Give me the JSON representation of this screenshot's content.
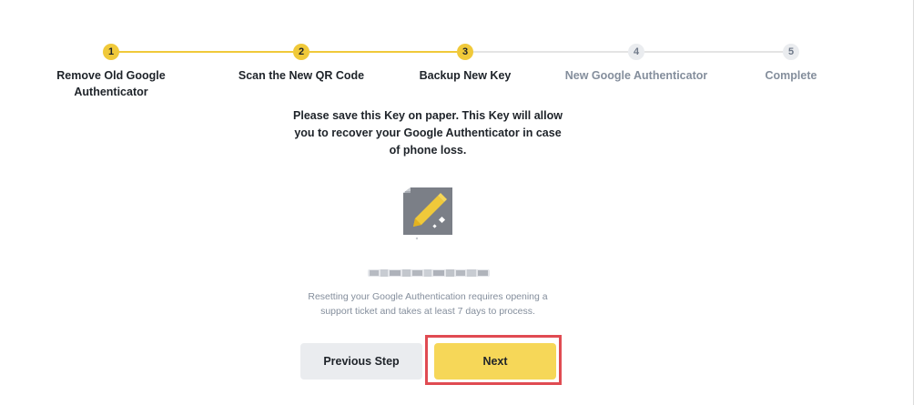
{
  "stepper": {
    "steps": [
      {
        "number": "1",
        "label": "Remove Old Google Authenticator",
        "state": "complete"
      },
      {
        "number": "2",
        "label": "Scan the New QR Code",
        "state": "complete"
      },
      {
        "number": "3",
        "label": "Backup New Key",
        "state": "current"
      },
      {
        "number": "4",
        "label": "New Google Authenticator",
        "state": "upcoming"
      },
      {
        "number": "5",
        "label": "Complete",
        "state": "upcoming"
      }
    ]
  },
  "main": {
    "notice": "Please save this Key on paper. This Key will allow you to recover your Google Authenticator in case of phone loss.",
    "icon": "paper-pencil-icon",
    "key_value_state": "blurred",
    "hint": "Resetting your Google Authentication requires opening a support ticket and takes at least 7 days to process."
  },
  "actions": {
    "previous_label": "Previous Step",
    "next_label": "Next"
  },
  "colors": {
    "accent": "#f0c93a",
    "next_button": "#f6d758",
    "highlight": "#e04b52"
  }
}
